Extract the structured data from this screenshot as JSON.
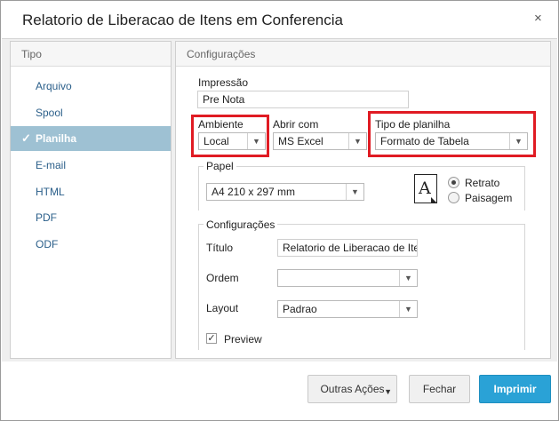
{
  "dialog": {
    "title": "Relatorio de Liberacao de Itens em Conferencia",
    "close_glyph": "×"
  },
  "left": {
    "header": "Tipo",
    "items": [
      {
        "label": "Arquivo",
        "selected": false
      },
      {
        "label": "Spool",
        "selected": false
      },
      {
        "label": "Planilha",
        "selected": true
      },
      {
        "label": "E-mail",
        "selected": false
      },
      {
        "label": "HTML",
        "selected": false
      },
      {
        "label": "PDF",
        "selected": false
      },
      {
        "label": "ODF",
        "selected": false
      }
    ],
    "check_glyph": "✓"
  },
  "right": {
    "header": "Configurações",
    "impressao": {
      "label": "Impressão",
      "value": "Pre Nota"
    },
    "ambiente": {
      "label": "Ambiente",
      "value": "Local"
    },
    "abrir_com": {
      "label": "Abrir com",
      "value": "MS Excel"
    },
    "tipo_planilha": {
      "label": "Tipo de planilha",
      "value": "Formato de Tabela"
    },
    "papel": {
      "legend": "Papel",
      "size": "A4 210 x 297 mm",
      "orientation_icon_letter": "A",
      "retrato": "Retrato",
      "paisagem": "Paisagem",
      "selected": "Retrato"
    },
    "config": {
      "legend": "Configurações",
      "titulo_label": "Título",
      "titulo_value": "Relatorio de Liberacao de Itens",
      "ordem_label": "Ordem",
      "ordem_value": "",
      "layout_label": "Layout",
      "layout_value": "Padrao",
      "preview_label": "Preview",
      "preview_checked": true
    }
  },
  "footer": {
    "outras_acoes": "Outras Ações",
    "fechar": "Fechar",
    "imprimir": "Imprimir"
  },
  "colors": {
    "highlight": "#e01b23",
    "selected_nav": "#9ec1d3",
    "primary_button": "#2aa2d6"
  },
  "glyphs": {
    "dropdown": "▼",
    "check": "✓"
  }
}
